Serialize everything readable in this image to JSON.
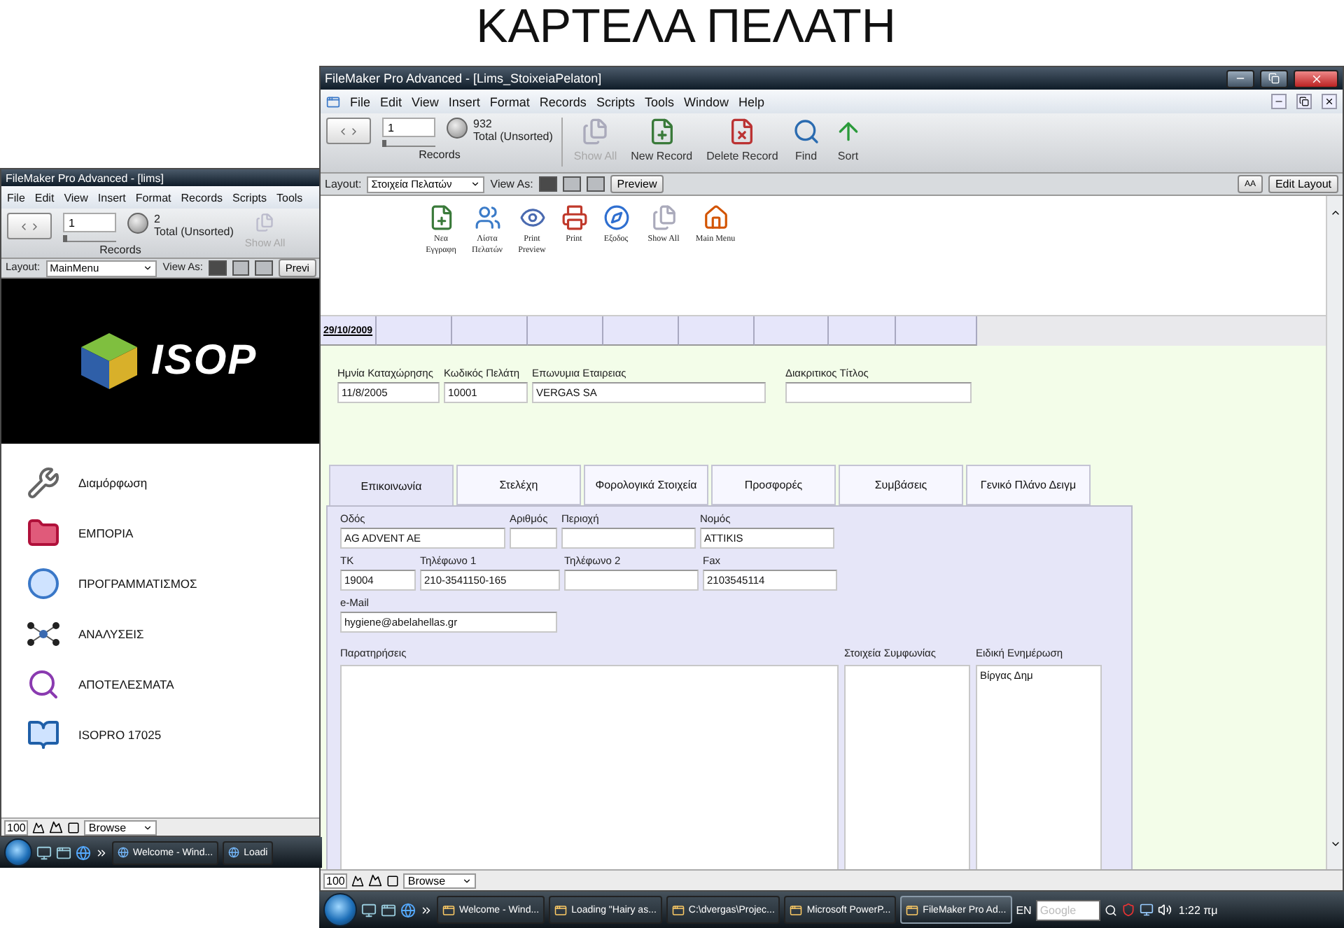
{
  "page_title": "ΚΑΡΤΕΛΑ ΠΕΛΑΤΗ",
  "back_window": {
    "title": "FileMaker Pro Advanced - [lims]",
    "menu": [
      "File",
      "Edit",
      "View",
      "Insert",
      "Format",
      "Records",
      "Scripts",
      "Tools"
    ],
    "record": "1",
    "record_slider": {
      "level": 0
    },
    "found": "2",
    "found_status": "Total (Unsorted)",
    "records_label": "Records",
    "show_all": {
      "label": "Show All",
      "disabled": true
    },
    "layout_label": "Layout:",
    "layout": "MainMenu",
    "view_as": "View As:",
    "views": [
      {
        "selected": true
      },
      {
        "selected": false
      },
      {
        "selected": false
      }
    ],
    "preview": "Previ",
    "logo": "ISOP",
    "menu_items": [
      {
        "kind": "tools",
        "label": "Διαμόρφωση"
      },
      {
        "kind": "folder",
        "label": "ΕΜΠΟΡΙΑ"
      },
      {
        "kind": "clock",
        "label": "ΠΡΟΓΡΑΜΜΑΤΙΣΜΟΣ"
      },
      {
        "kind": "network",
        "label": "ΑΝΑΛΥΣΕΙΣ"
      },
      {
        "kind": "magnifier",
        "label": "ΑΠΟΤΕΛΕΣΜΑΤΑ"
      },
      {
        "kind": "book",
        "label": "ISOPRO 17025"
      }
    ],
    "zoom": "100",
    "mode": "Browse"
  },
  "back_taskbar": {
    "items": [
      {
        "label": "Welcome - Wind...",
        "selected": false
      },
      {
        "label": "Loadi",
        "selected": false
      }
    ]
  },
  "main_window": {
    "title": "FileMaker Pro Advanced - [Lims_StoixeiaPelaton]",
    "menu": [
      "File",
      "Edit",
      "View",
      "Insert",
      "Format",
      "Records",
      "Scripts",
      "Tools",
      "Window",
      "Help"
    ],
    "record": "1",
    "record_slider": {
      "level": 0
    },
    "found": "932",
    "found_status": "Total (Unsorted)",
    "records_label": "Records",
    "tools": [
      {
        "kind": "show_all",
        "label": "Show All",
        "disabled": true
      },
      {
        "kind": "new",
        "label": "New Record",
        "disabled": false
      },
      {
        "kind": "delete",
        "label": "Delete Record",
        "disabled": false
      },
      {
        "kind": "find",
        "label": "Find",
        "disabled": false
      },
      {
        "kind": "sort",
        "label": "Sort",
        "disabled": false
      }
    ],
    "layout_label": "Layout:",
    "layout": "Στοιχεία Πελατών",
    "view_as": "View As:",
    "views": [
      {
        "selected": true
      },
      {
        "selected": false
      },
      {
        "selected": false
      }
    ],
    "preview": "Preview",
    "text_format": "AA",
    "edit_layout": "Edit Layout",
    "shortcuts": [
      {
        "kind": "new",
        "label": "Νεα Εγγραφη"
      },
      {
        "kind": "list",
        "label": "Λίστα Πελατών"
      },
      {
        "kind": "preview",
        "label": "Print Preview"
      },
      {
        "kind": "print",
        "label": "Print"
      },
      {
        "kind": "exit",
        "label": "Εξοδος"
      },
      {
        "kind": "show_all",
        "label": "Show All"
      },
      {
        "kind": "home",
        "label": "Main Menu"
      }
    ],
    "header_date": "29/10/2009",
    "record_fields": [
      {
        "label": "Ημνία Καταχώρησης",
        "value": "11/8/2005"
      },
      {
        "label": "Κωδικός Πελάτη",
        "value": "10001"
      },
      {
        "label": "Επωνυμια Εταιρειας",
        "value": "VERGAS SA"
      },
      {
        "label": "Διακριτικος Τίτλος"
      }
    ],
    "tabs": [
      {
        "label": "Επικοινωνία",
        "selected": true
      },
      {
        "label": "Στελέχη",
        "selected": false
      },
      {
        "label": "Φορολογικά Στοιχεία",
        "selected": false
      },
      {
        "label": "Προσφορές",
        "selected": false
      },
      {
        "label": "Συμβάσεις",
        "selected": false
      },
      {
        "label": "Γενικό Πλάνο Δειγμ",
        "selected": false
      }
    ],
    "contact_rows": [
      [
        {
          "label": "Οδός",
          "value": "AG ADVENT AE"
        },
        {
          "label": "Αριθμός"
        },
        {
          "label": "Περιοχή"
        },
        {
          "label": "Νομός",
          "value": "ATTIKIS"
        }
      ],
      [
        {
          "label": "ΤΚ",
          "value": "19004"
        },
        {
          "label": "Τηλέφωνο 1",
          "value": "210-3541150-165"
        },
        {
          "label": "Τηλέφωνο 2"
        },
        {
          "label": "Fax",
          "value": "2103545114"
        }
      ],
      [
        {
          "label": "e-Mail",
          "value": "hygiene@abelahellas.gr"
        }
      ]
    ],
    "notes_label": "Παρατηρήσεις",
    "agreement_label": "Στοιχεία Συμφωνίας",
    "update_label": "Ειδική Ενημέρωση",
    "update_value": "Βίργας Δημ",
    "zoom": "100",
    "mode": "Browse"
  },
  "taskbar": {
    "items": [
      {
        "label": "Welcome - Wind...",
        "selected": false
      },
      {
        "label": "Loading \"Hairy as...",
        "selected": false
      },
      {
        "label": "C:\\dvergas\\Projec...",
        "selected": false
      },
      {
        "label": "Microsoft PowerP...",
        "selected": false
      },
      {
        "label": "FileMaker Pro Ad...",
        "selected": true
      }
    ],
    "language": "EN",
    "search_placeholder": "Google",
    "clock": "1:22 πμ"
  }
}
